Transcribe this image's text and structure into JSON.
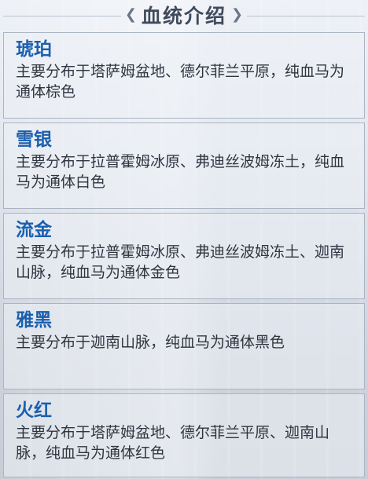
{
  "header": {
    "title": "血统介绍",
    "deco_left": "❮",
    "deco_right": "❯"
  },
  "bloodlines": [
    {
      "name": "琥珀",
      "desc": "主要分布于塔萨姆盆地、德尔菲兰平原，纯血马为通体棕色"
    },
    {
      "name": "雪银",
      "desc": "主要分布于拉普霍姆冰原、弗迪丝波姆冻土，纯血马为通体白色"
    },
    {
      "name": "流金",
      "desc": "主要分布于拉普霍姆冰原、弗迪丝波姆冻土、迦南山脉，纯血马为通体金色"
    },
    {
      "name": "雅黑",
      "desc": "主要分布于迦南山脉，纯血马为通体黑色"
    },
    {
      "name": "火红",
      "desc": "主要分布于塔萨姆盆地、德尔菲兰平原、迦南山脉，纯血马为通体红色"
    }
  ]
}
